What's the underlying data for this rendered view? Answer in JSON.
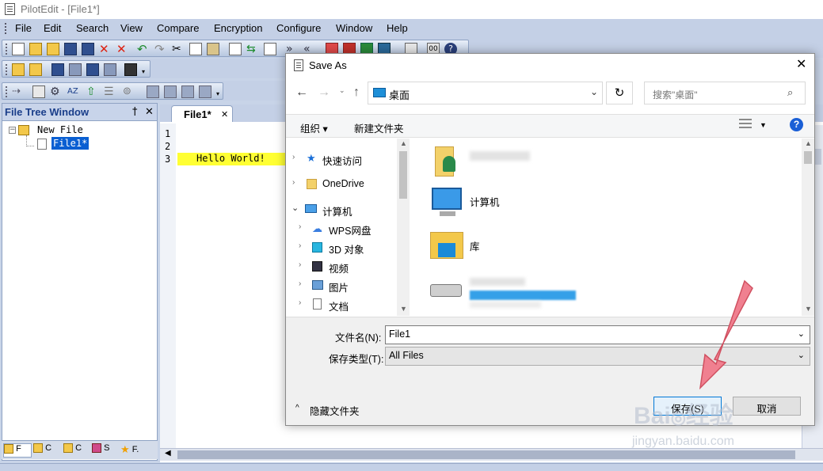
{
  "window": {
    "title": "PilotEdit - [File1*]"
  },
  "menu": [
    "File",
    "Edit",
    "Search",
    "View",
    "Compare",
    "Encryption",
    "Configure",
    "Window",
    "Help"
  ],
  "file_tree": {
    "title": "File Tree Window",
    "pin": "†",
    "close": "✕",
    "root": "New File",
    "child": "File1*",
    "bottom_tabs": [
      "F",
      "C",
      "C",
      "S",
      "F."
    ]
  },
  "editor": {
    "tab": "File1*",
    "tab_close": "✕",
    "lines": [
      "1",
      "2",
      "3"
    ],
    "line3_text": "Hello World!"
  },
  "dialog": {
    "title": "Save As",
    "address": "桌面",
    "search_placeholder": "搜索\"桌面\"",
    "organize": "组织 ▾",
    "new_folder": "新建文件夹",
    "nav": [
      "快速访问",
      "OneDrive",
      "计算机",
      "WPS网盘",
      "3D 对象",
      "视频",
      "图片",
      "文档"
    ],
    "files": [
      "计算机",
      "库"
    ],
    "filename_label": "文件名(N):",
    "filename_value": "File1",
    "filetype_label": "保存类型(T):",
    "filetype_value": "All Files",
    "hide_folders": "隐藏文件夹",
    "save": "保存(S)",
    "cancel": "取消"
  },
  "watermark": "jingyan.baidu.com",
  "colors": {
    "accent": "#1a5fd6",
    "highlight": "#ffff33",
    "arrow": "#f07080"
  }
}
